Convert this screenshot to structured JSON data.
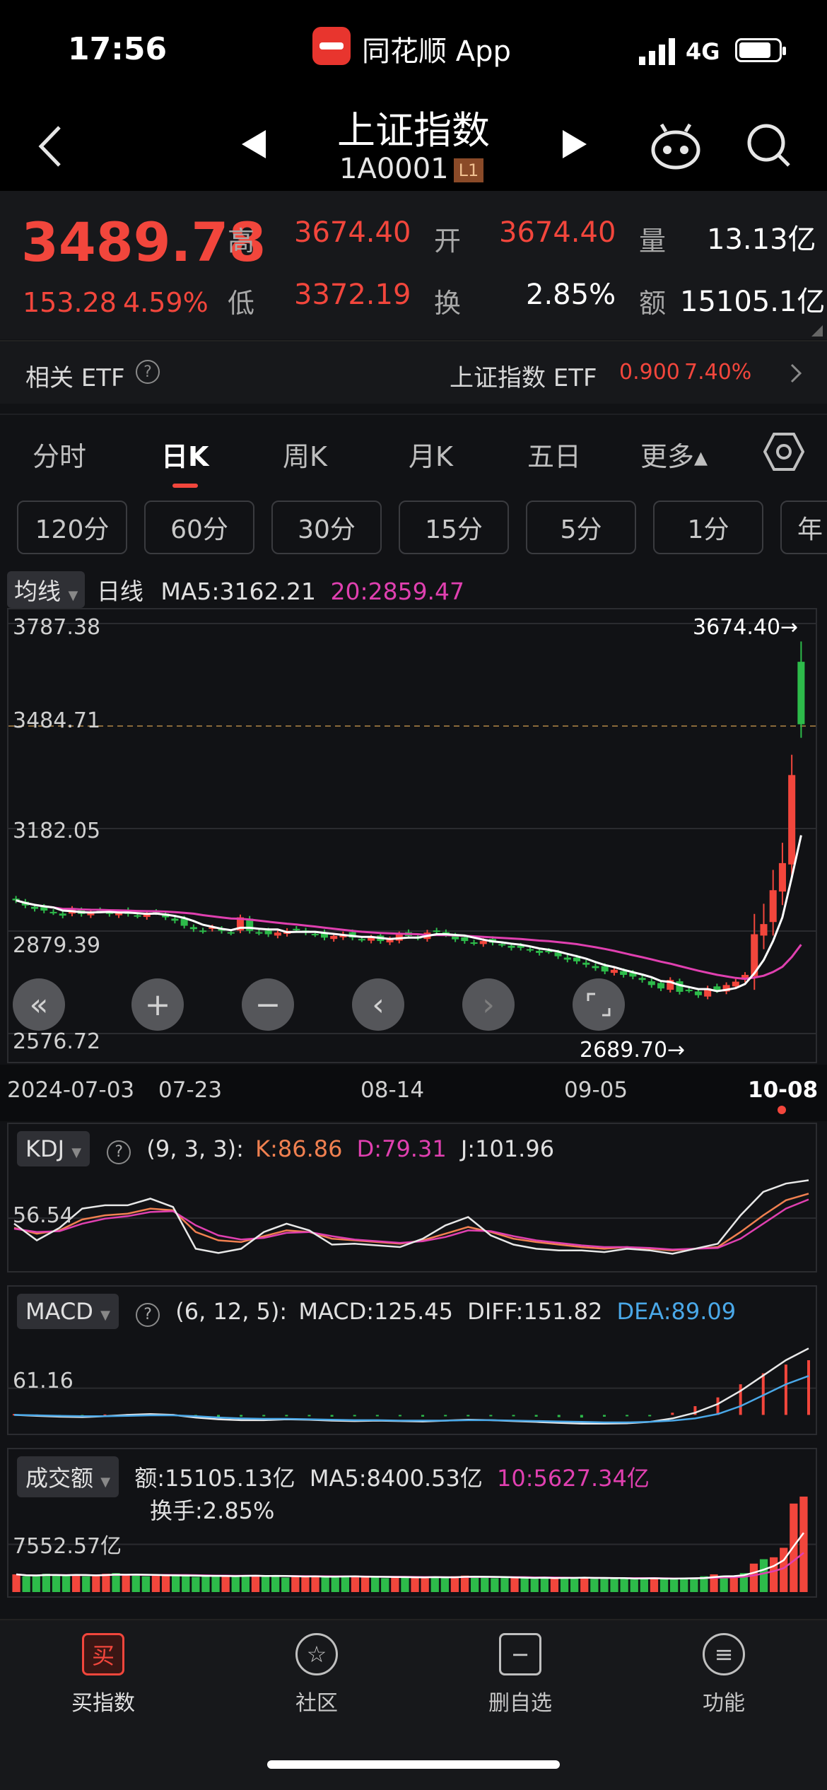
{
  "status": {
    "time": "17:56",
    "app_name": "同花顺 App",
    "network": "4G"
  },
  "header": {
    "title": "上证指数",
    "code": "1A0001",
    "level_badge": "L1"
  },
  "quote": {
    "price": "3489.78",
    "change": "153.28",
    "change_pct": "4.59%",
    "high_label": "高",
    "high": "3674.40",
    "low_label": "低",
    "low": "3372.19",
    "open_label": "开",
    "open": "3674.40",
    "turnover_label": "换",
    "turnover": "2.85%",
    "volume_label": "量",
    "volume": "13.13亿",
    "amount_label": "额",
    "amount": "15105.1亿"
  },
  "etf": {
    "label": "相关 ETF",
    "name": "上证指数 ETF",
    "price": "0.900",
    "pct": "7.40%"
  },
  "tabs": [
    "分时",
    "日K",
    "周K",
    "月K",
    "五日",
    "更多▴"
  ],
  "active_tab": "日K",
  "subtabs": [
    "120分",
    "60分",
    "30分",
    "15分",
    "5分",
    "1分",
    "年"
  ],
  "ma_bar": {
    "toggle": "均线",
    "period": "日线",
    "ma5": "MA5:3162.21",
    "ma20": "20:2859.47"
  },
  "main_chart": {
    "y_labels": [
      "3787.38",
      "3484.71",
      "3182.05",
      "2879.39",
      "2576.72"
    ],
    "max_label": "3674.40→",
    "min_label": "2689.70→",
    "x_labels": [
      "2024-07-03",
      "07-23",
      "08-14",
      "09-05",
      "10-08"
    ]
  },
  "kdj": {
    "name": "KDJ",
    "params": "(9, 3, 3):",
    "k": "K:86.86",
    "d": "D:79.31",
    "j": "J:101.96",
    "y_label": "56.54"
  },
  "macd": {
    "name": "MACD",
    "params": "(6, 12, 5):",
    "macd": "MACD:125.45",
    "diff": "DIFF:151.82",
    "dea": "DEA:89.09",
    "y_label": "61.16"
  },
  "vol": {
    "name": "成交额",
    "amount": "额:15105.13亿",
    "ma5": "MA5:8400.53亿",
    "ma10": "10:5627.34亿",
    "turnover": "换手:2.85%",
    "y_label": "7552.57亿"
  },
  "bottom_nav": [
    {
      "label": "买指数",
      "icon": "买"
    },
    {
      "label": "社区",
      "icon": "☆"
    },
    {
      "label": "删自选",
      "icon": "−"
    },
    {
      "label": "功能",
      "icon": "≡"
    }
  ],
  "colors": {
    "up": "#f2463c",
    "down": "#2dbb4a",
    "ma5": "#ffffff",
    "ma20": "#e040b0",
    "dea": "#4aa8e8"
  },
  "chart_data": [
    {
      "type": "candlestick",
      "x_range": [
        "2024-07-03",
        "2024-10-08"
      ],
      "x_ticks": [
        "2024-07-03",
        "07-23",
        "08-14",
        "09-05",
        "10-08"
      ],
      "ylim": [
        2576.72,
        3787.38
      ],
      "y_ticks": [
        3787.38,
        3484.71,
        3182.05,
        2879.39,
        2576.72
      ],
      "close": [
        2970,
        2955,
        2945,
        2940,
        2935,
        2925,
        2945,
        2930,
        2935,
        2940,
        2930,
        2935,
        2930,
        2925,
        2930,
        2935,
        2920,
        2910,
        2895,
        2885,
        2880,
        2890,
        2880,
        2875,
        2920,
        2880,
        2875,
        2870,
        2875,
        2880,
        2885,
        2875,
        2870,
        2860,
        2865,
        2870,
        2860,
        2855,
        2860,
        2850,
        2855,
        2870,
        2865,
        2860,
        2875,
        2880,
        2870,
        2855,
        2850,
        2845,
        2850,
        2845,
        2840,
        2830,
        2830,
        2825,
        2815,
        2820,
        2805,
        2795,
        2790,
        2780,
        2770,
        2760,
        2765,
        2750,
        2745,
        2735,
        2720,
        2710,
        2735,
        2700,
        2705,
        2690,
        2710,
        2705,
        2720,
        2730,
        2750,
        2870,
        2900,
        3000,
        3080,
        3340,
        3490
      ],
      "max_label": 3674.4,
      "min_label": 2689.7,
      "ma5_last": 3162.21,
      "ma20_last": 2859.47
    },
    {
      "type": "line",
      "name": "KDJ",
      "ylim": [
        0,
        110
      ],
      "series": [
        {
          "name": "K",
          "values": [
            45,
            38,
            42,
            55,
            60,
            62,
            68,
            66,
            40,
            30,
            28,
            35,
            42,
            40,
            32,
            30,
            28,
            26,
            30,
            38,
            46,
            40,
            32,
            28,
            25,
            22,
            20,
            22,
            20,
            18,
            20,
            22,
            40,
            60,
            78,
            86
          ]
        },
        {
          "name": "D",
          "values": [
            44,
            40,
            41,
            50,
            56,
            59,
            64,
            65,
            48,
            36,
            31,
            33,
            39,
            40,
            35,
            31,
            29,
            27,
            29,
            34,
            42,
            41,
            35,
            30,
            27,
            24,
            22,
            22,
            21,
            19,
            20,
            21,
            32,
            50,
            68,
            79
          ]
        },
        {
          "name": "J",
          "values": [
            50,
            30,
            45,
            68,
            72,
            72,
            80,
            70,
            20,
            15,
            20,
            40,
            50,
            42,
            25,
            26,
            24,
            22,
            32,
            48,
            58,
            36,
            25,
            20,
            18,
            18,
            16,
            20,
            18,
            14,
            20,
            26,
            60,
            88,
            98,
            102
          ]
        }
      ]
    },
    {
      "type": "bar",
      "name": "MACD",
      "ylim": [
        -30,
        180
      ],
      "values": [
        2,
        1,
        -2,
        -3,
        1,
        2,
        3,
        2,
        -4,
        -5,
        -4,
        -3,
        -2,
        -3,
        -4,
        -3,
        -2,
        -3,
        -4,
        -2,
        -1,
        -2,
        -3,
        -4,
        -5,
        -6,
        -4,
        -3,
        -2,
        5,
        20,
        40,
        70,
        95,
        115,
        125
      ],
      "series": [
        {
          "name": "DIFF",
          "values": [
            0,
            -2,
            -4,
            -5,
            -3,
            0,
            2,
            0,
            -6,
            -10,
            -12,
            -12,
            -10,
            -11,
            -13,
            -14,
            -13,
            -14,
            -15,
            -13,
            -11,
            -12,
            -14,
            -16,
            -18,
            -20,
            -20,
            -19,
            -16,
            -8,
            5,
            25,
            55,
            90,
            125,
            152
          ]
        },
        {
          "name": "DEA",
          "values": [
            0,
            -1,
            -2,
            -3,
            -3,
            -2,
            -1,
            -1,
            -3,
            -6,
            -8,
            -9,
            -9,
            -10,
            -11,
            -12,
            -12,
            -13,
            -13,
            -13,
            -12,
            -12,
            -13,
            -14,
            -15,
            -16,
            -17,
            -17,
            -16,
            -13,
            -8,
            2,
            20,
            45,
            70,
            89
          ]
        }
      ]
    },
    {
      "type": "bar",
      "name": "成交额",
      "unit": "亿",
      "ylim": [
        0,
        17000
      ],
      "values": [
        2800,
        2500,
        2600,
        2900,
        2700,
        2600,
        2800,
        2500,
        2600,
        2900,
        3000,
        2700,
        2600,
        2500,
        2800,
        2700,
        2600,
        2500,
        2400,
        2600,
        2700,
        2500,
        2400,
        2600,
        2700,
        2500,
        2600,
        2300,
        2400,
        2500,
        2600,
        2400,
        2300,
        2500,
        2600,
        2400,
        2300,
        2200,
        2400,
        2500,
        2300,
        2200,
        2400,
        2300,
        2500,
        2600,
        2400,
        2300,
        2200,
        2400,
        2300,
        2200,
        2100,
        2300,
        2200,
        2400,
        2200,
        2300,
        2100,
        2200,
        2300,
        2100,
        2000,
        2200,
        2300,
        2100,
        2000,
        2200,
        2300,
        2500,
        2800,
        2600,
        2400,
        3000,
        4500,
        5200,
        5500,
        7000,
        14000,
        15105
      ],
      "series": [
        {
          "name": "MA5",
          "last": 8400.53
        },
        {
          "name": "MA10",
          "last": 5627.34
        }
      ]
    }
  ]
}
